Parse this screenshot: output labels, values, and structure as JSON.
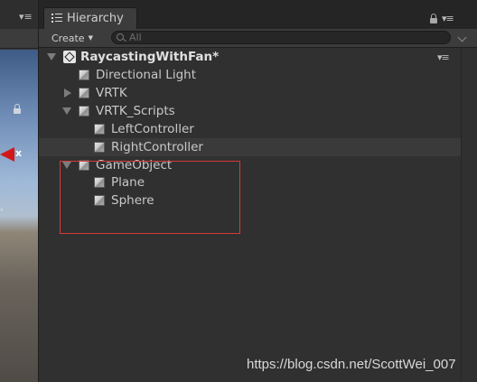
{
  "left_panel": {
    "menu_glyph": "▾≡",
    "axis_label": "x",
    "side_text": "‹",
    "lock_icon": "lock-icon"
  },
  "hierarchy": {
    "tab_label": "Hierarchy",
    "tab_icon": "list-icon",
    "lock_icon": "lock-icon",
    "menu_glyph": "▾≡",
    "create_label": "Create",
    "create_caret": "▼",
    "search_placeholder": "All",
    "scene": {
      "name": "RaycastingWithFan*",
      "menu_glyph": "▾≡"
    },
    "items": [
      {
        "label": "Directional Light",
        "depth": 1,
        "expander": "none"
      },
      {
        "label": "VRTK",
        "depth": 1,
        "expander": "collapsed"
      },
      {
        "label": "VRTK_Scripts",
        "depth": 1,
        "expander": "expanded"
      },
      {
        "label": "LeftController",
        "depth": 2,
        "expander": "none"
      },
      {
        "label": "RightController",
        "depth": 2,
        "expander": "none",
        "selected": true
      },
      {
        "label": "GameObject",
        "depth": 1,
        "expander": "expanded"
      },
      {
        "label": "Plane",
        "depth": 2,
        "expander": "none"
      },
      {
        "label": "Sphere",
        "depth": 2,
        "expander": "none"
      }
    ]
  },
  "annotation": {
    "color": "#d63a3a"
  },
  "watermark": "https://blog.csdn.net/ScottWei_007",
  "colors": {
    "panel_bg": "#303030",
    "toolbar_bg": "#3c3c3c",
    "text": "#c9c9c9",
    "highlight": "#d63a3a"
  }
}
